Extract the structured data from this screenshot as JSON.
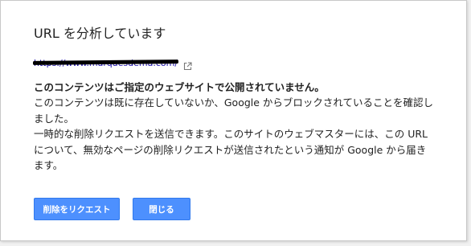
{
  "dialog": {
    "title": "URL を分析しています",
    "url": "https://www.marquesdema.com/",
    "external_link_icon": "external-link-icon",
    "heading": "このコンテンツはご指定のウェブサイトで公開されていません。",
    "paragraph1": "このコンテンツは既に存在していないか、Google からブロックされていることを確認しました。",
    "paragraph2": "一時的な削除リクエストを送信できます。このサイトのウェブマスターには、この URL について、無効なページの削除リクエストが送信されたという通知が Google から届きます。",
    "request_button_label": "削除をリクエスト",
    "close_button_label": "閉じる"
  },
  "colors": {
    "button_blue": "#4d90fe",
    "link_blue": "#1a0dab",
    "text": "#222222"
  }
}
